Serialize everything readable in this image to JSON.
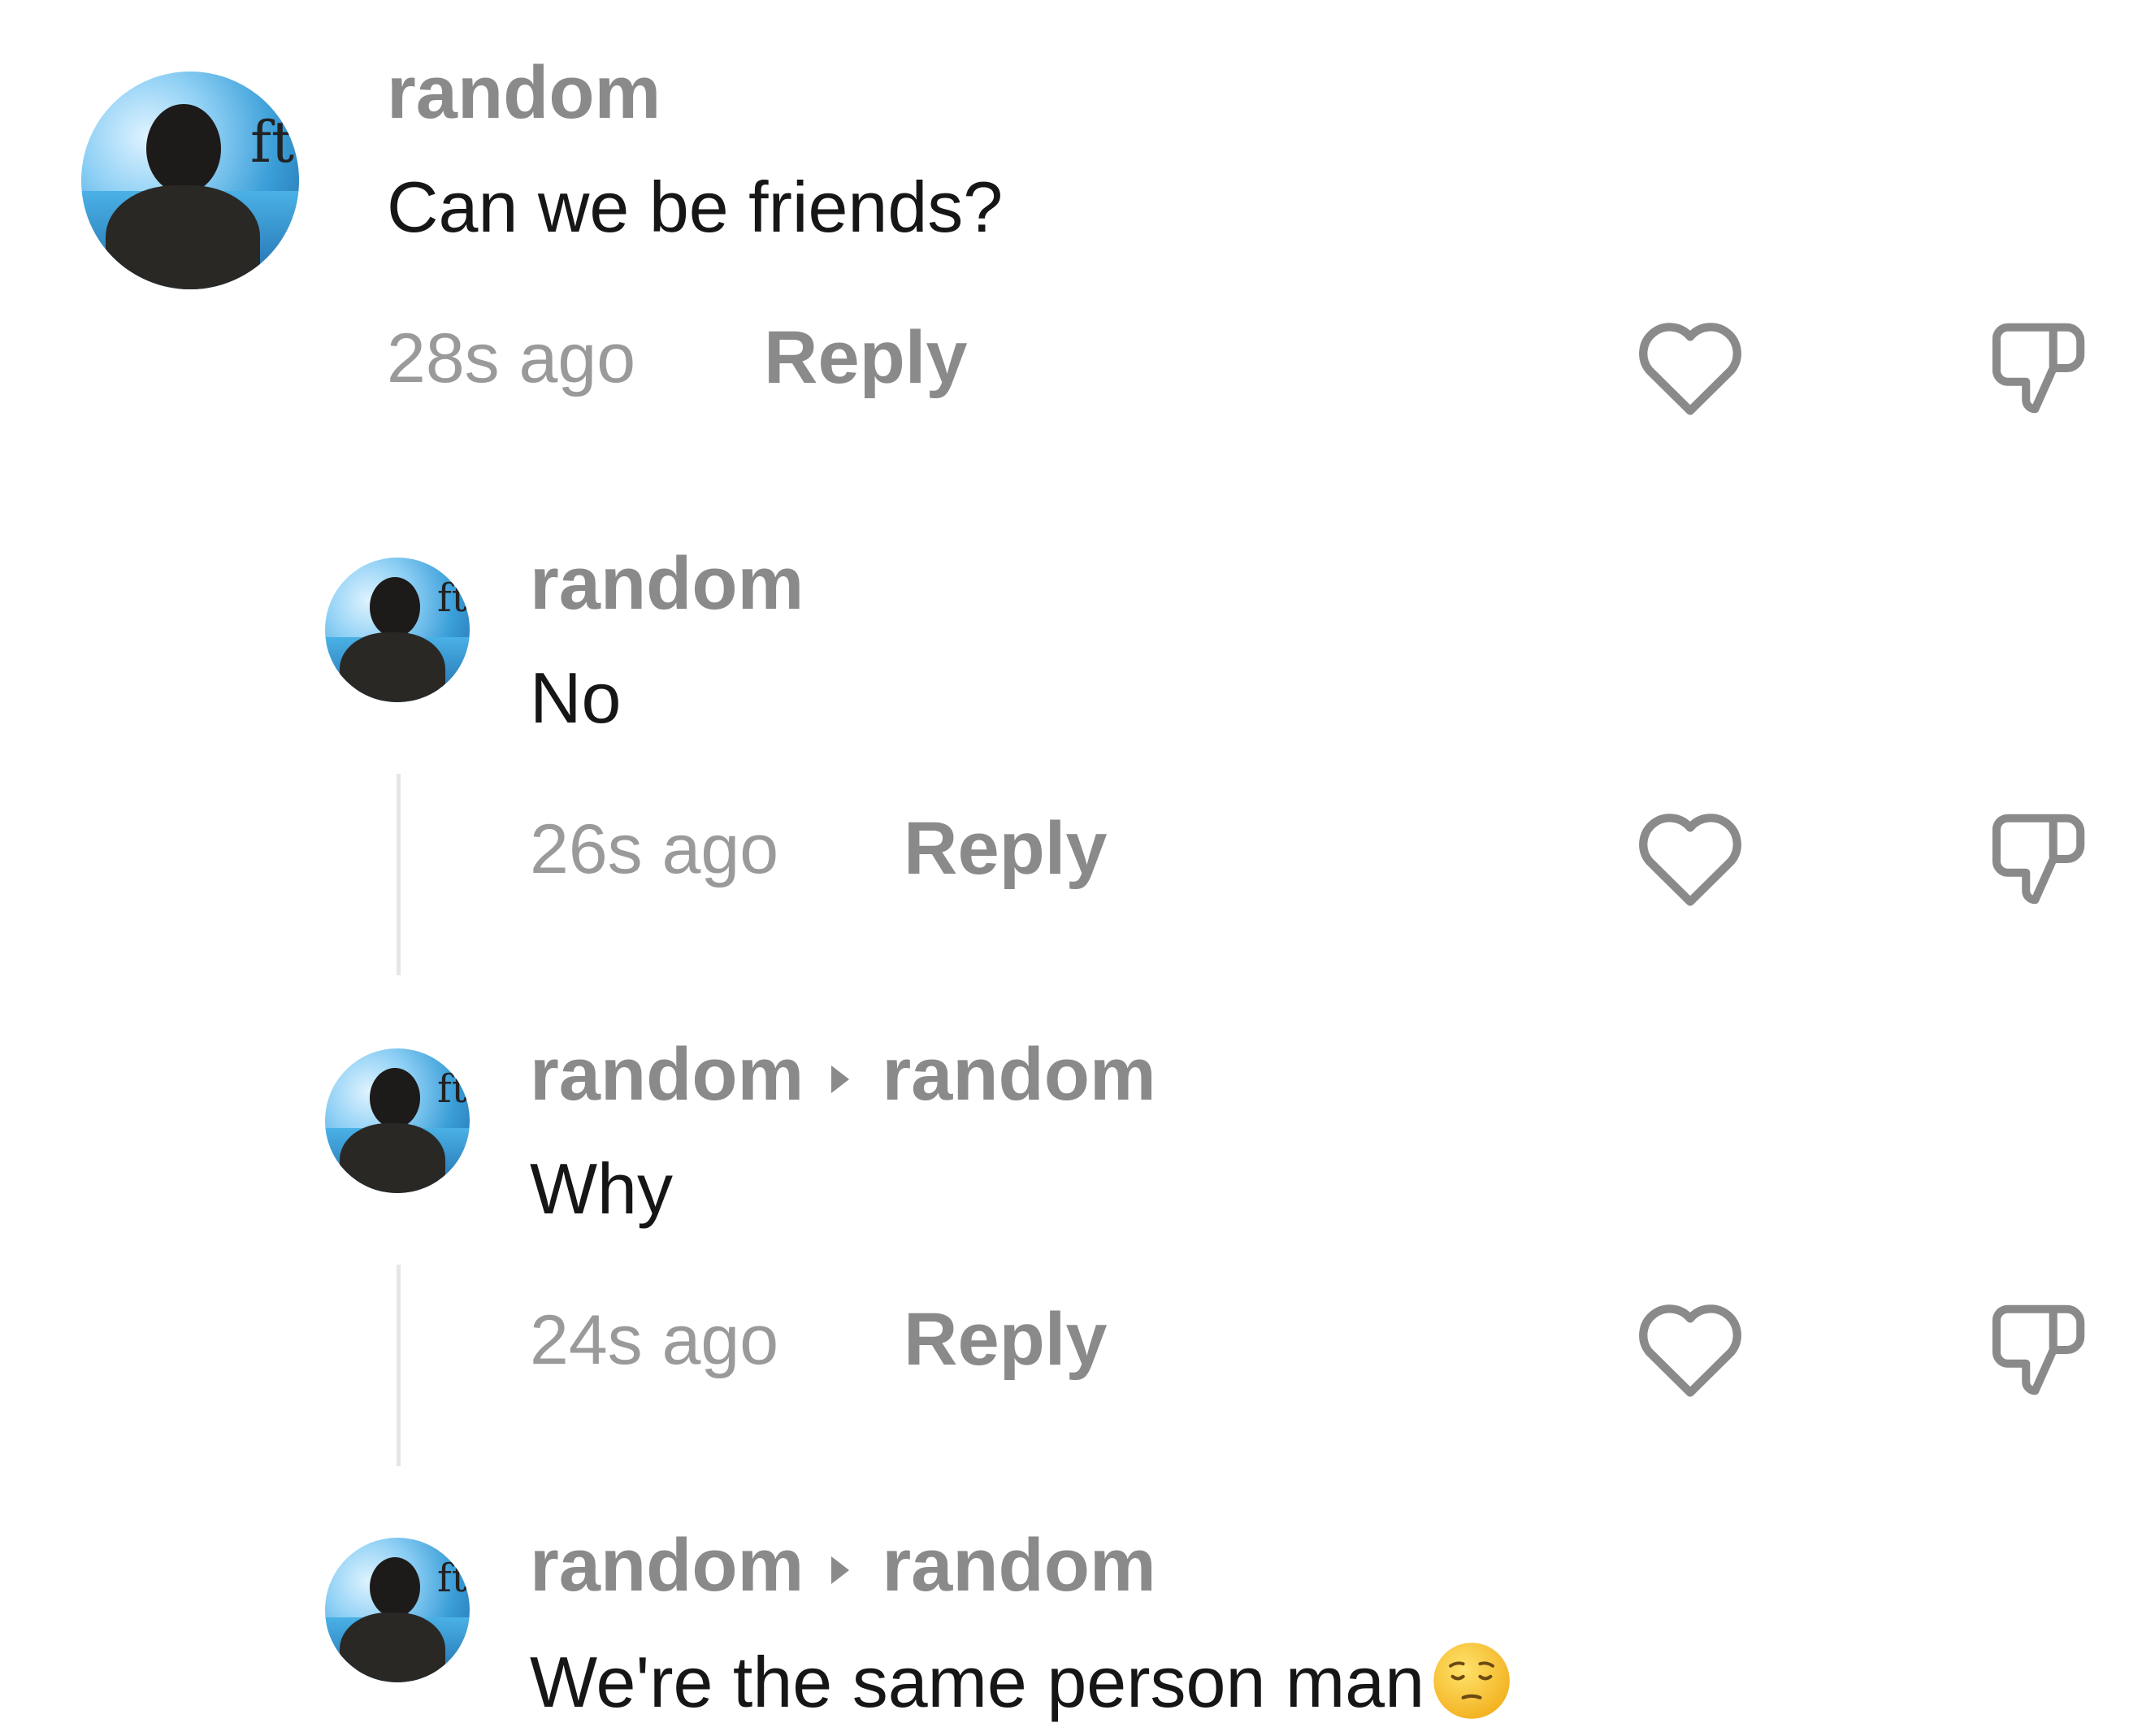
{
  "comments": [
    {
      "username": "random",
      "text": "Can we be friends?",
      "time": "28s ago",
      "reply_label": "Reply"
    },
    {
      "username": "random",
      "text": "No",
      "time": "26s ago",
      "reply_label": "Reply"
    },
    {
      "username": "random",
      "reply_to": "random",
      "text": "Why",
      "time": "24s ago",
      "reply_label": "Reply"
    },
    {
      "username": "random",
      "reply_to": "random",
      "text": "We're the same person man",
      "emoji": "pensive-face-emoji"
    }
  ],
  "avatar_mark": "ft",
  "colors": {
    "username": "#8a8a8a",
    "timestamp": "#9a9a9a",
    "body_text": "#161616",
    "icon": "#8a8a8a",
    "emoji": "#f7c234"
  }
}
